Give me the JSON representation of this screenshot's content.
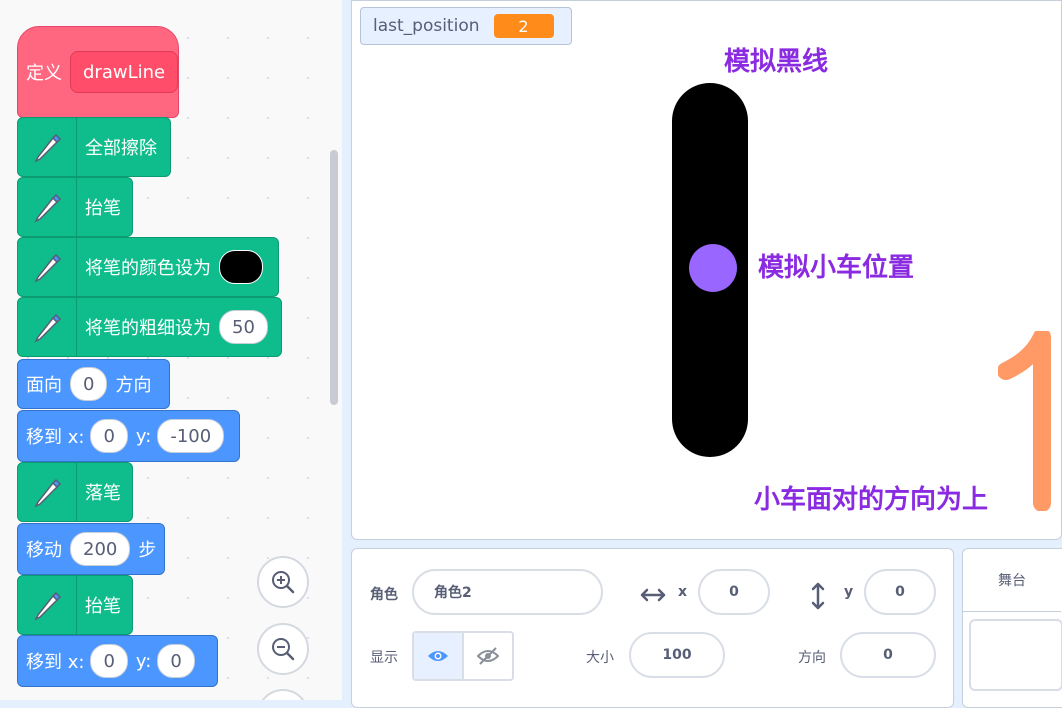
{
  "blocks": {
    "define_label": "定义",
    "define_name": "drawLine",
    "erase_all": "全部擦除",
    "pen_up": "抬笔",
    "set_pen_color": "将笔的颜色设为",
    "set_pen_size": "将笔的粗细设为",
    "pen_size_value": "50",
    "point_in_direction": "面向",
    "direction_value": "0",
    "direction_suffix": "方向",
    "goto_label": "移到 x:",
    "goto_x": "0",
    "goto_y_label": "y:",
    "goto_y": "-100",
    "pen_down": "落笔",
    "move_label": "移动",
    "move_value": "200",
    "move_suffix": "步",
    "pen_up2": "抬笔",
    "goto2_label": "移到 x:",
    "goto2_x": "0",
    "goto2_y_label": "y:",
    "goto2_y": "0"
  },
  "stage": {
    "monitor_label": "last_position",
    "monitor_value": "2",
    "black_line_text": "模拟黑线",
    "car_text": "模拟小车位置",
    "direction_text": "小车面对的方向为上",
    "number_glyph": "1"
  },
  "sprite_info": {
    "sprite_label": "角色",
    "sprite_name": "角色2",
    "x_label": "x",
    "x_value": "0",
    "y_label": "y",
    "y_value": "0",
    "show_label": "显示",
    "size_label": "大小",
    "size_value": "100",
    "direction_label": "方向",
    "direction_value": "0"
  },
  "stage_panel": {
    "title": "舞台"
  },
  "colors": {
    "pen": "#0fbd8c",
    "motion": "#4c97ff",
    "define": "#ff6680",
    "monitor": "#ff8c1a",
    "annotation": "#8a2be2",
    "car": "#9966ff",
    "number": "#ff9966"
  }
}
